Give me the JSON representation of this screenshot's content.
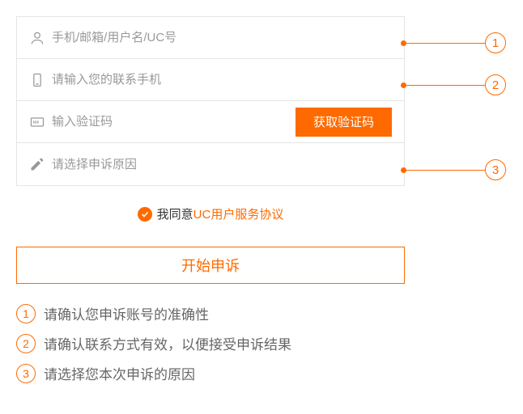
{
  "form": {
    "account_placeholder": "手机/邮箱/用户名/UC号",
    "phone_placeholder": "请输入您的联系手机",
    "captcha_placeholder": "输入验证码",
    "get_code_label": "获取验证码",
    "reason_placeholder": "请选择申诉原因"
  },
  "agreement": {
    "prefix": "我同意",
    "link": "UC用户服务协议"
  },
  "submit_label": "开始申诉",
  "notes": [
    "请确认您申诉账号的准确性",
    "请确认联系方式有效，以便接受申诉结果",
    "请选择您本次申诉的原因"
  ],
  "callout_numbers": [
    "1",
    "2",
    "3"
  ]
}
